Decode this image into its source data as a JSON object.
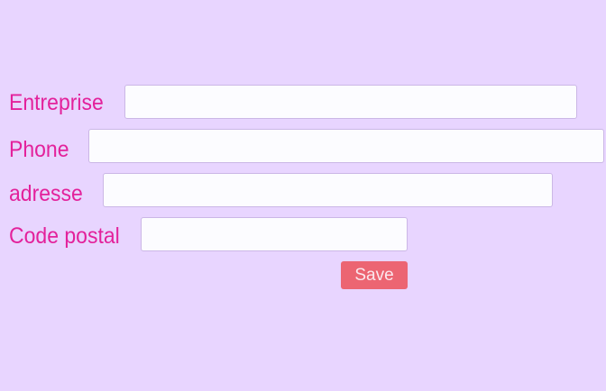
{
  "form": {
    "fields": [
      {
        "label": "Entreprise",
        "value": "",
        "placeholder": ""
      },
      {
        "label": "Phone",
        "value": "",
        "placeholder": ""
      },
      {
        "label": "adresse",
        "value": "",
        "placeholder": ""
      },
      {
        "label": "Code postal",
        "value": "",
        "placeholder": ""
      }
    ],
    "save_label": "Save"
  },
  "colors": {
    "background": "#e8d5ff",
    "label": "#e3219b",
    "input_background": "#fcfcff",
    "save_button": "#ec6572"
  }
}
